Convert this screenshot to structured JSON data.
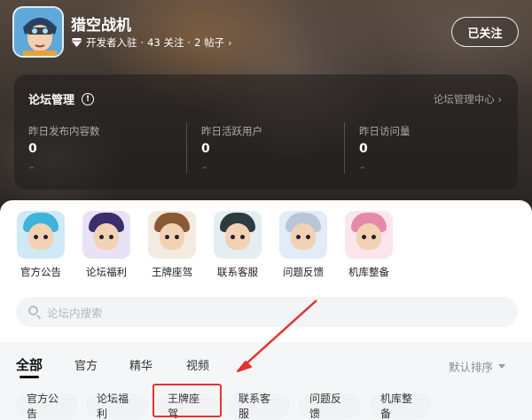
{
  "header": {
    "game_title": "猎空战机",
    "meta_verified": "开发者入驻",
    "meta_sep1": "·",
    "meta_follows": "43 关注",
    "meta_sep2": "·",
    "meta_posts": "2 帖子",
    "follow_button": "已关注"
  },
  "management": {
    "title": "论坛管理",
    "center_link": "论坛管理中心 ›",
    "stats": [
      {
        "label": "昨日发布内容数",
        "value": "0",
        "change": "–"
      },
      {
        "label": "昨日活跃用户",
        "value": "0",
        "change": "–"
      },
      {
        "label": "昨日访问量",
        "value": "0",
        "change": "–"
      }
    ]
  },
  "shortcuts": [
    {
      "label": "官方公告"
    },
    {
      "label": "论坛福利"
    },
    {
      "label": "王牌座驾"
    },
    {
      "label": "联系客服"
    },
    {
      "label": "问题反馈"
    },
    {
      "label": "机库整备"
    }
  ],
  "search": {
    "placeholder": "论坛内搜索"
  },
  "tabs": [
    {
      "label": "全部"
    },
    {
      "label": "官方"
    },
    {
      "label": "精华"
    },
    {
      "label": "视频"
    }
  ],
  "sort": {
    "label": "默认排序"
  },
  "chips": [
    {
      "label": "官方公告"
    },
    {
      "label": "论坛福利"
    },
    {
      "label": "王牌座驾"
    },
    {
      "label": "联系客服"
    },
    {
      "label": "问题反馈"
    },
    {
      "label": "机库整备"
    }
  ],
  "colors": {
    "annotation": "#e5322d",
    "chip_bg": "#f1f2f4"
  },
  "icons": {
    "verified": "diamond-badge-icon",
    "info": "info-circle-icon",
    "search": "search-icon",
    "sort": "caret-down-icon"
  }
}
